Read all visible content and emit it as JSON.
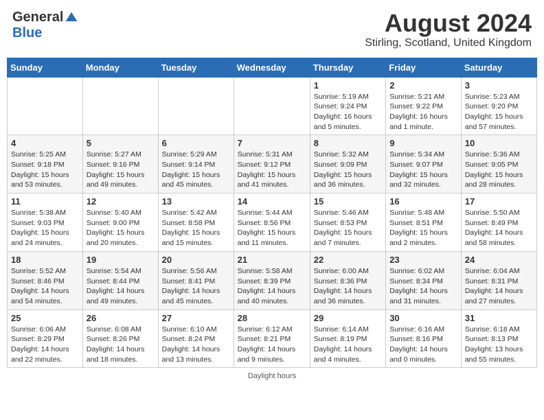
{
  "header": {
    "logo_general": "General",
    "logo_blue": "Blue",
    "month_title": "August 2024",
    "location": "Stirling, Scotland, United Kingdom"
  },
  "weekdays": [
    "Sunday",
    "Monday",
    "Tuesday",
    "Wednesday",
    "Thursday",
    "Friday",
    "Saturday"
  ],
  "footer": {
    "daylight_label": "Daylight hours"
  },
  "weeks": [
    [
      {
        "day": "",
        "info": ""
      },
      {
        "day": "",
        "info": ""
      },
      {
        "day": "",
        "info": ""
      },
      {
        "day": "",
        "info": ""
      },
      {
        "day": "1",
        "info": "Sunrise: 5:19 AM\nSunset: 9:24 PM\nDaylight: 16 hours\nand 5 minutes."
      },
      {
        "day": "2",
        "info": "Sunrise: 5:21 AM\nSunset: 9:22 PM\nDaylight: 16 hours\nand 1 minute."
      },
      {
        "day": "3",
        "info": "Sunrise: 5:23 AM\nSunset: 9:20 PM\nDaylight: 15 hours\nand 57 minutes."
      }
    ],
    [
      {
        "day": "4",
        "info": "Sunrise: 5:25 AM\nSunset: 9:18 PM\nDaylight: 15 hours\nand 53 minutes."
      },
      {
        "day": "5",
        "info": "Sunrise: 5:27 AM\nSunset: 9:16 PM\nDaylight: 15 hours\nand 49 minutes."
      },
      {
        "day": "6",
        "info": "Sunrise: 5:29 AM\nSunset: 9:14 PM\nDaylight: 15 hours\nand 45 minutes."
      },
      {
        "day": "7",
        "info": "Sunrise: 5:31 AM\nSunset: 9:12 PM\nDaylight: 15 hours\nand 41 minutes."
      },
      {
        "day": "8",
        "info": "Sunrise: 5:32 AM\nSunset: 9:09 PM\nDaylight: 15 hours\nand 36 minutes."
      },
      {
        "day": "9",
        "info": "Sunrise: 5:34 AM\nSunset: 9:07 PM\nDaylight: 15 hours\nand 32 minutes."
      },
      {
        "day": "10",
        "info": "Sunrise: 5:36 AM\nSunset: 9:05 PM\nDaylight: 15 hours\nand 28 minutes."
      }
    ],
    [
      {
        "day": "11",
        "info": "Sunrise: 5:38 AM\nSunset: 9:03 PM\nDaylight: 15 hours\nand 24 minutes."
      },
      {
        "day": "12",
        "info": "Sunrise: 5:40 AM\nSunset: 9:00 PM\nDaylight: 15 hours\nand 20 minutes."
      },
      {
        "day": "13",
        "info": "Sunrise: 5:42 AM\nSunset: 8:58 PM\nDaylight: 15 hours\nand 15 minutes."
      },
      {
        "day": "14",
        "info": "Sunrise: 5:44 AM\nSunset: 8:56 PM\nDaylight: 15 hours\nand 11 minutes."
      },
      {
        "day": "15",
        "info": "Sunrise: 5:46 AM\nSunset: 8:53 PM\nDaylight: 15 hours\nand 7 minutes."
      },
      {
        "day": "16",
        "info": "Sunrise: 5:48 AM\nSunset: 8:51 PM\nDaylight: 15 hours\nand 2 minutes."
      },
      {
        "day": "17",
        "info": "Sunrise: 5:50 AM\nSunset: 8:49 PM\nDaylight: 14 hours\nand 58 minutes."
      }
    ],
    [
      {
        "day": "18",
        "info": "Sunrise: 5:52 AM\nSunset: 8:46 PM\nDaylight: 14 hours\nand 54 minutes."
      },
      {
        "day": "19",
        "info": "Sunrise: 5:54 AM\nSunset: 8:44 PM\nDaylight: 14 hours\nand 49 minutes."
      },
      {
        "day": "20",
        "info": "Sunrise: 5:56 AM\nSunset: 8:41 PM\nDaylight: 14 hours\nand 45 minutes."
      },
      {
        "day": "21",
        "info": "Sunrise: 5:58 AM\nSunset: 8:39 PM\nDaylight: 14 hours\nand 40 minutes."
      },
      {
        "day": "22",
        "info": "Sunrise: 6:00 AM\nSunset: 8:36 PM\nDaylight: 14 hours\nand 36 minutes."
      },
      {
        "day": "23",
        "info": "Sunrise: 6:02 AM\nSunset: 8:34 PM\nDaylight: 14 hours\nand 31 minutes."
      },
      {
        "day": "24",
        "info": "Sunrise: 6:04 AM\nSunset: 8:31 PM\nDaylight: 14 hours\nand 27 minutes."
      }
    ],
    [
      {
        "day": "25",
        "info": "Sunrise: 6:06 AM\nSunset: 8:29 PM\nDaylight: 14 hours\nand 22 minutes."
      },
      {
        "day": "26",
        "info": "Sunrise: 6:08 AM\nSunset: 8:26 PM\nDaylight: 14 hours\nand 18 minutes."
      },
      {
        "day": "27",
        "info": "Sunrise: 6:10 AM\nSunset: 8:24 PM\nDaylight: 14 hours\nand 13 minutes."
      },
      {
        "day": "28",
        "info": "Sunrise: 6:12 AM\nSunset: 8:21 PM\nDaylight: 14 hours\nand 9 minutes."
      },
      {
        "day": "29",
        "info": "Sunrise: 6:14 AM\nSunset: 8:19 PM\nDaylight: 14 hours\nand 4 minutes."
      },
      {
        "day": "30",
        "info": "Sunrise: 6:16 AM\nSunset: 8:16 PM\nDaylight: 14 hours\nand 0 minutes."
      },
      {
        "day": "31",
        "info": "Sunrise: 6:18 AM\nSunset: 8:13 PM\nDaylight: 13 hours\nand 55 minutes."
      }
    ]
  ]
}
